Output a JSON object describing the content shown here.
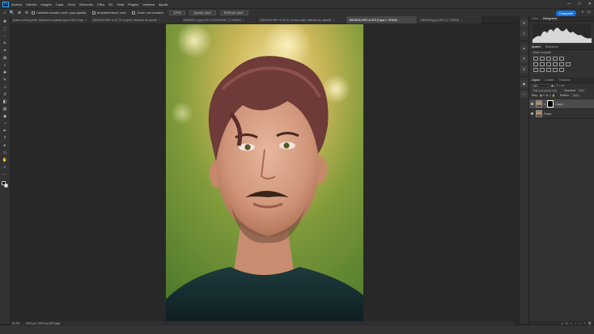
{
  "app": {
    "logo": "Ps",
    "menu": [
      "Archivo",
      "Edición",
      "Imagen",
      "Capa",
      "Texto",
      "Selección",
      "Filtro",
      "3D",
      "Vista",
      "Plugins",
      "Ventana",
      "Ayuda"
    ],
    "window_controls": {
      "minimize": "—",
      "maximize": "□",
      "close": "✕"
    }
  },
  "options_bar": {
    "tool_icon": "magnifier-icon",
    "zoom_in": "⊕",
    "zoom_out": "⊖",
    "checks": [
      "Cambiar tamaño vent. para ajustar",
      "Ampliar/reducir vent.",
      "Zoom con arrastre"
    ],
    "zoom_value": "100%",
    "fit_button": "Ajustar pant.",
    "fill_button": "Rellenar pant.",
    "share_button": "Compartir"
  },
  "tabs": [
    {
      "label": "Ballenz-zeitung-Weil_Wyrdivid-kompliziert.jpg al 50% (Capa 1, RGB/8*)",
      "active": false
    },
    {
      "label": "20615464.HEIF al 33,7% (Capa 6, Máscara de capa/8)",
      "active": false
    },
    {
      "label": "20623645_3.jpg al 56,7% (20623645_3, RGB/8*)",
      "active": false
    },
    {
      "label": "20623645.HEIF al 33,3% (Fondo copia, Máscara de capa/8)",
      "active": false
    },
    {
      "label": "20623630.ARW al 32% (Capa 1, RGB/8)",
      "active": true
    },
    {
      "label": "20623633.jpg al 50% (C, RGB/8)",
      "active": false
    }
  ],
  "tools": [
    "move-icon",
    "marquee-icon",
    "lasso-icon",
    "quick-select-icon",
    "crop-icon",
    "frame-icon",
    "eyedropper-icon",
    "healing-icon",
    "brush-icon",
    "stamp-icon",
    "history-brush-icon",
    "eraser-icon",
    "gradient-icon",
    "blur-icon",
    "dodge-icon",
    "pen-icon",
    "type-icon",
    "path-select-icon",
    "rectangle-icon",
    "hand-icon",
    "zoom-icon",
    "more-icon"
  ],
  "status": {
    "zoom": "31,9%",
    "doc_info": "3024 px x 3024 px (300 ppp)"
  },
  "panels": {
    "histogram_tabs": [
      "Color",
      "Histograma"
    ],
    "adjust_tabs": [
      "Ajustes",
      "Bibliotecas"
    ],
    "adjust_label": "Añadir un ajuste",
    "layers_tabs": [
      "Capas",
      "Canales",
      "Trazados"
    ],
    "kind_filter": "Tipo",
    "blend_mode": "Sobreexposición color",
    "opacity_label": "Opacidad:",
    "opacity_value": "60%",
    "lock_label": "Bloq.:",
    "fill_label": "Relleno:",
    "fill_value": "100%",
    "layers": [
      {
        "name": "Capa 1",
        "selected": true,
        "has_mask": true
      },
      {
        "name": "Fondo",
        "selected": false,
        "has_mask": false
      }
    ]
  }
}
